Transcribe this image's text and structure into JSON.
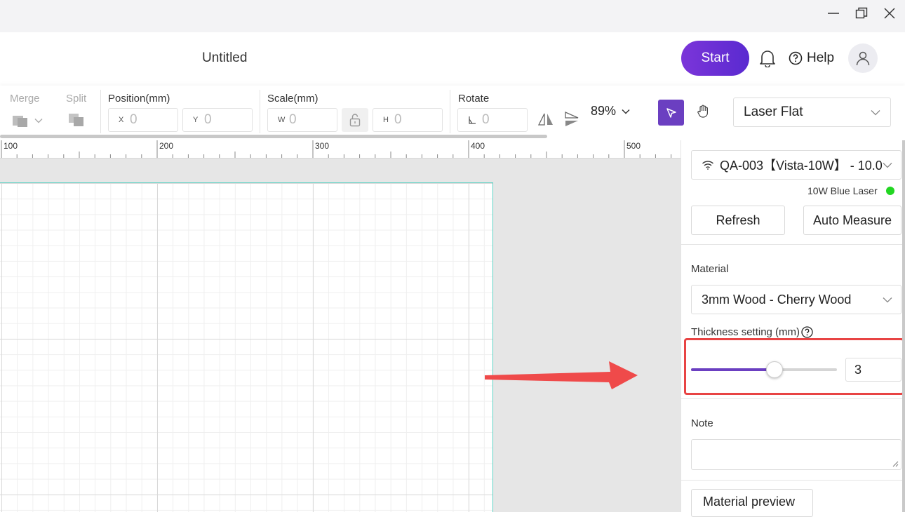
{
  "header": {
    "title": "Untitled",
    "start_label": "Start",
    "help_label": "Help"
  },
  "toolbar": {
    "merge_label": "Merge",
    "split_label": "Split",
    "position_label": "Position(mm)",
    "x_prefix": "X",
    "x_value": "0",
    "y_prefix": "Y",
    "y_value": "0",
    "scale_label": "Scale(mm)",
    "w_prefix": "W",
    "w_value": "0",
    "h_prefix": "H",
    "h_value": "0",
    "rotate_label": "Rotate",
    "rotate_value": "0",
    "zoom_label": "89%",
    "mode_label": "Laser Flat"
  },
  "ruler": {
    "ticks": [
      "100",
      "200",
      "300",
      "400",
      "500"
    ]
  },
  "panel": {
    "device_label": "QA-003【Vista-10W】 - 10.0",
    "laser_label": "10W Blue Laser",
    "refresh_label": "Refresh",
    "auto_measure_label": "Auto Measure",
    "material_heading": "Material",
    "material_value": "3mm Wood - Cherry Wood",
    "thickness_heading": "Thickness setting (mm)",
    "thickness_value": "3",
    "thickness_fraction": 0.57,
    "note_heading": "Note",
    "preview_label": "Material preview"
  },
  "colors": {
    "accent": "#6b3fc1",
    "start_gradient_from": "#7b35d9",
    "start_gradient_to": "#5a2ad0",
    "status_ok": "#22d622",
    "highlight": "#e84444",
    "workspace_border": "#5fd3c4"
  },
  "icons": [
    "minimize-icon",
    "restore-icon",
    "close-icon",
    "bell-icon",
    "help-circle-icon",
    "user-icon",
    "merge-icon",
    "split-icon",
    "lock-icon",
    "flip-horizontal-icon",
    "flip-vertical-icon",
    "cursor-icon",
    "hand-icon",
    "chevron-down-icon",
    "wifi-icon",
    "question-icon"
  ]
}
